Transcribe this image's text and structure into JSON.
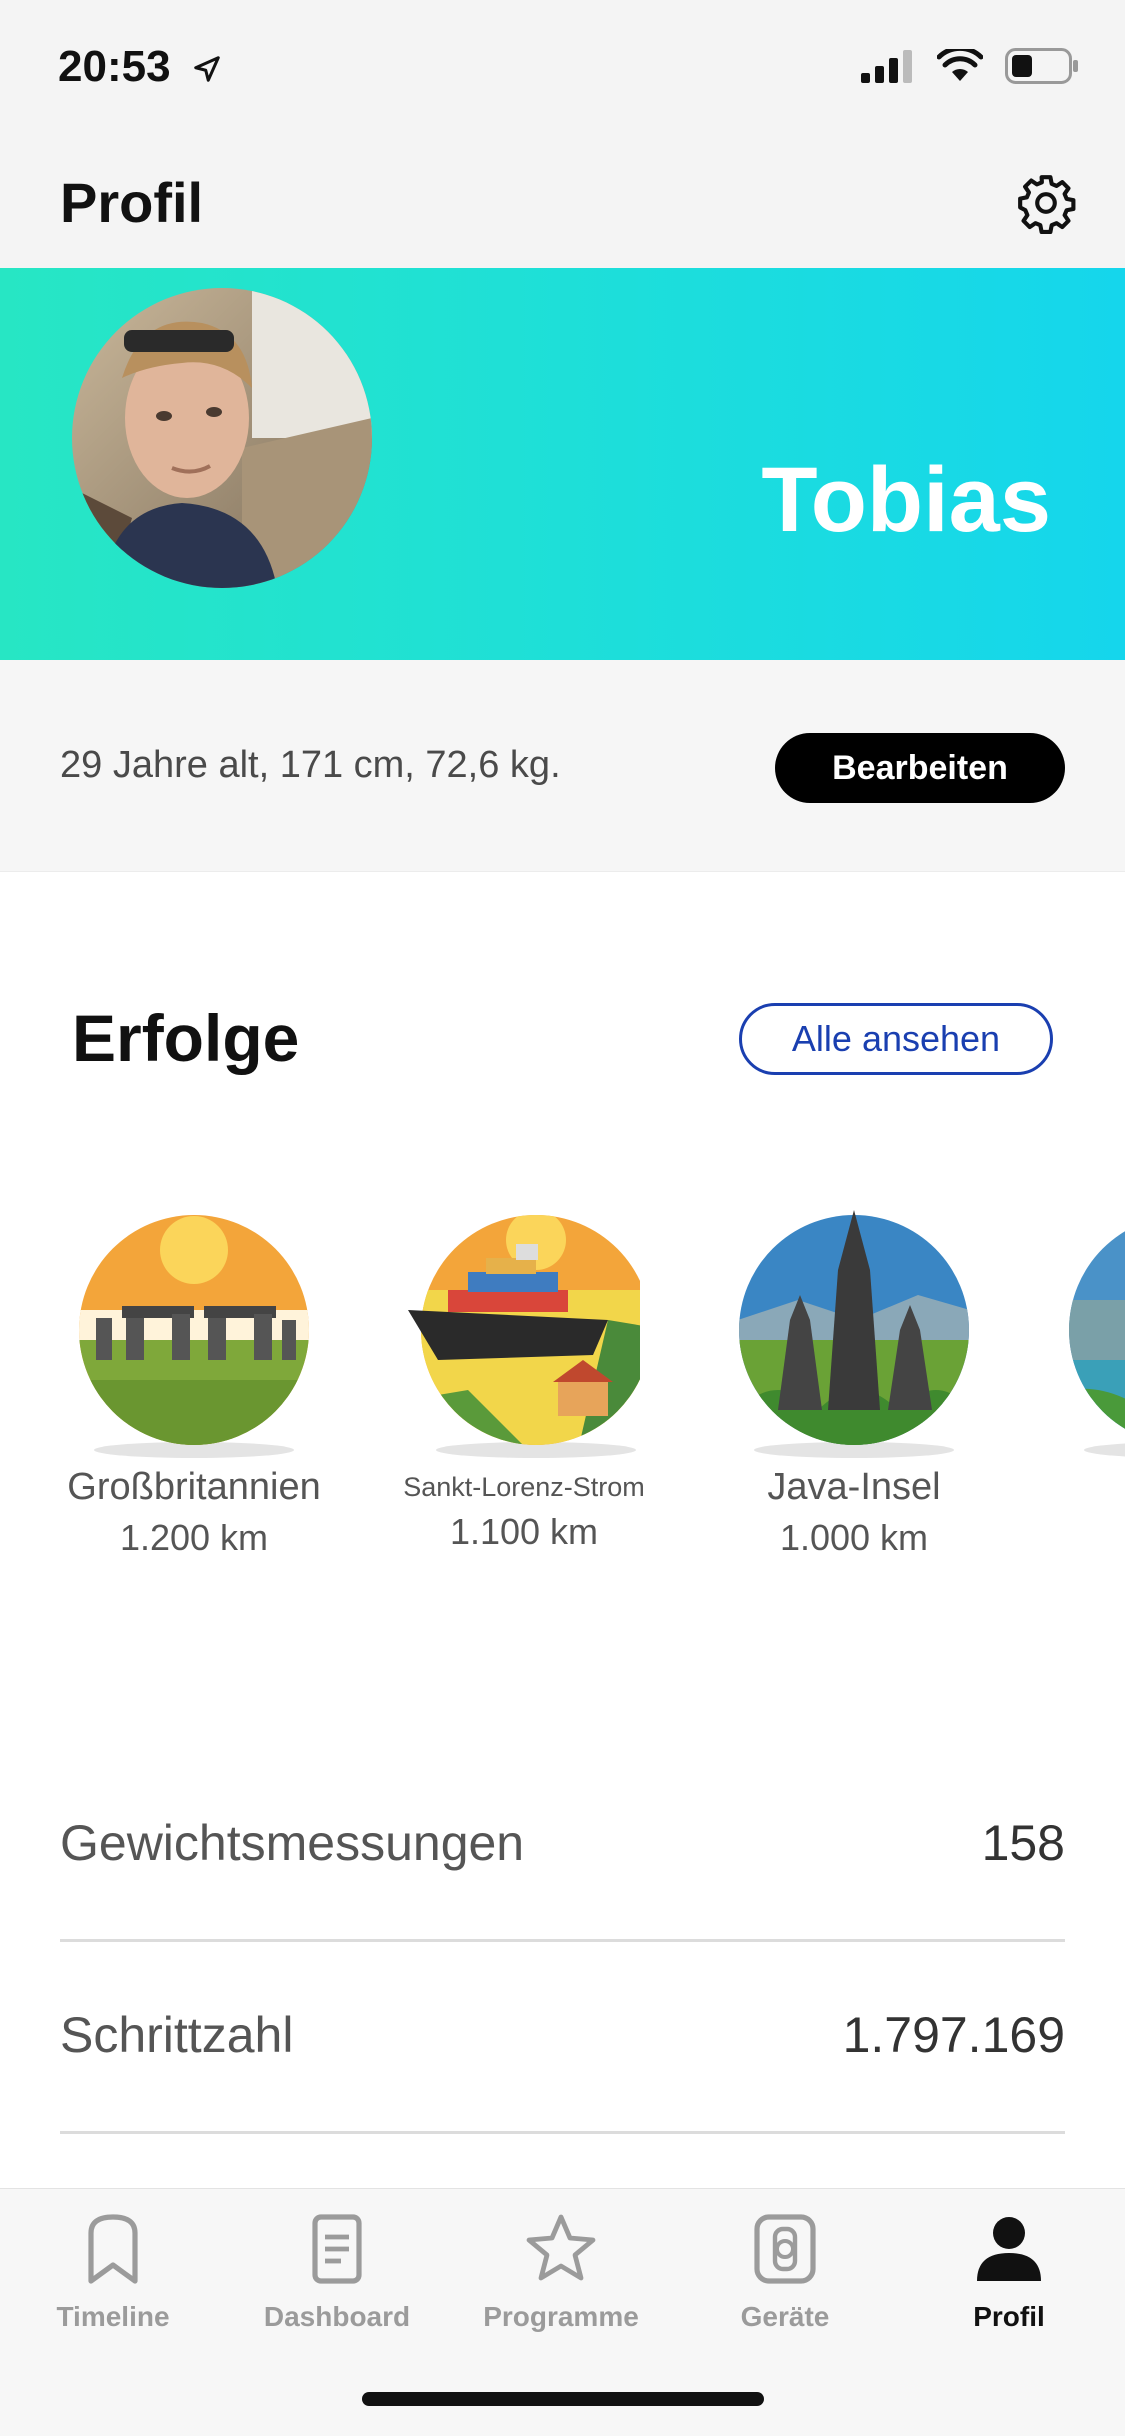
{
  "status_bar": {
    "time": "20:53"
  },
  "header": {
    "title": "Profil",
    "settings_icon": "gear-icon"
  },
  "profile": {
    "name": "Tobias",
    "info": "29 Jahre alt, 171 cm, 72,6 kg.",
    "edit_label": "Bearbeiten",
    "banner_colors": [
      "#27e6c4",
      "#15d6ec"
    ]
  },
  "achievements": {
    "title": "Erfolge",
    "see_all_label": "Alle ansehen",
    "items": [
      {
        "name": "Großbritannien",
        "distance": "1.200 km"
      },
      {
        "name": "Sankt-Lorenz-Strom",
        "distance": "1.100 km"
      },
      {
        "name": "Java-Insel",
        "distance": "1.000 km"
      }
    ]
  },
  "stats": [
    {
      "label": "Gewichtsmessungen",
      "value": "158"
    },
    {
      "label": "Schrittzahl",
      "value": "1.797.169"
    }
  ],
  "tabs": [
    {
      "label": "Timeline",
      "icon": "bookmark-icon",
      "active": false
    },
    {
      "label": "Dashboard",
      "icon": "document-icon",
      "active": false
    },
    {
      "label": "Programme",
      "icon": "star-icon",
      "active": false
    },
    {
      "label": "Geräte",
      "icon": "watch-icon",
      "active": false
    },
    {
      "label": "Profil",
      "icon": "person-icon",
      "active": true
    }
  ],
  "colors": {
    "accent_blue": "#1a3fb0",
    "tab_inactive": "#9b9b9b",
    "tab_active": "#111111"
  }
}
